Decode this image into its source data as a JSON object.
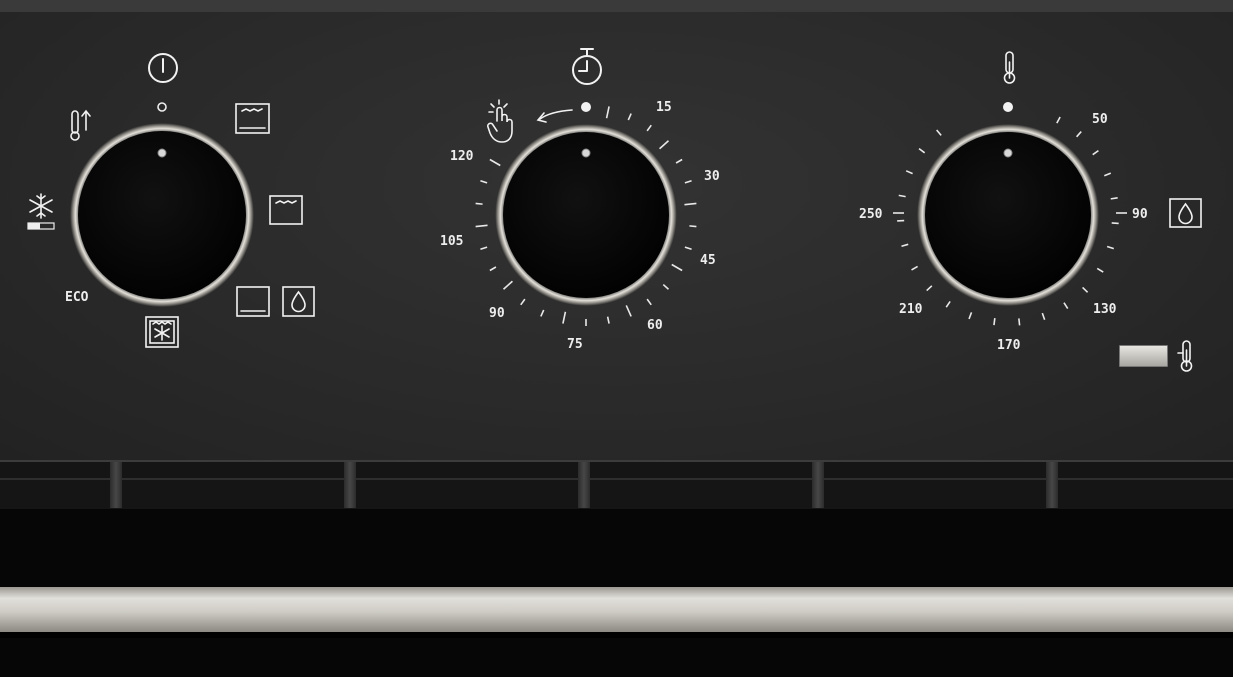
{
  "function_knob": {
    "label_eco": "ECO",
    "icons": [
      "power-icon",
      "off-position-dot",
      "top-down-heat-icon",
      "defrost-icon",
      "top-bottom-heat-icon",
      "top-heat-icon",
      "bottom-heat-icon",
      "steam-cleaning-icon",
      "fan-grill-icon"
    ]
  },
  "timer_knob": {
    "scale": [
      "15",
      "30",
      "45",
      "60",
      "75",
      "90",
      "105",
      "120"
    ],
    "icons": [
      "stopwatch-icon",
      "manual-mode-icon",
      "rotate-arrow-icon"
    ]
  },
  "temperature_knob": {
    "scale": [
      "50",
      "90",
      "130",
      "170",
      "210",
      "250"
    ],
    "icons": [
      "thermometer-icon",
      "steam-cleaning-icon"
    ]
  },
  "indicator": {
    "icons": [
      "indicator-lamp",
      "thermometer-icon"
    ]
  },
  "colors": {
    "panel": "#2a2a2a",
    "knob": "#050505",
    "ring": "#d9d6cf",
    "text": "#eeeeee",
    "handle": "#d6d3cd"
  }
}
